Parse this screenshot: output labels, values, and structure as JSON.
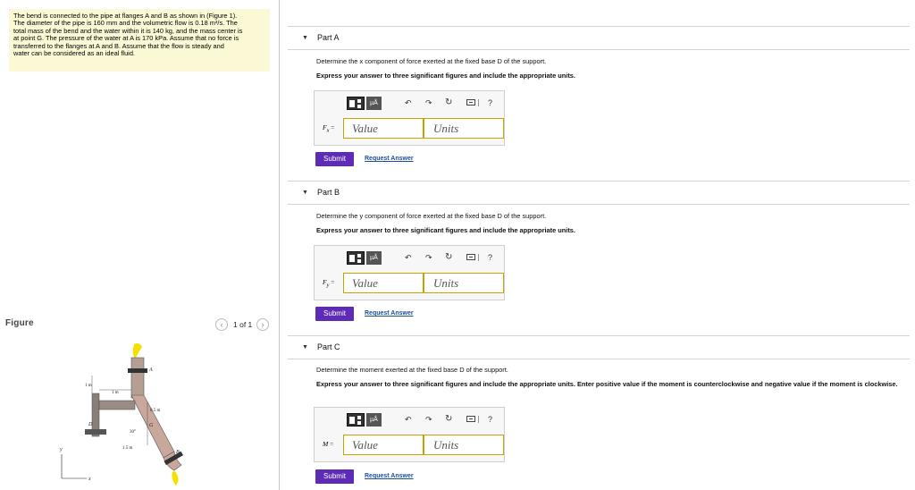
{
  "problem": {
    "lines": [
      "The bend is connected to the pipe at flanges A and B as shown in (Figure 1).",
      "The diameter of the pipe is 160 mm and the volumetric flow is 0.18 m³/s. The",
      "total mass of the bend and the water within it is 140 kg, and the mass center is",
      "at point G. The pressure of the water at A is 170 kPa. Assume that no force is",
      "transferred to the flanges at A and B. Assume that the flow is steady and",
      "water can be considered as an ideal fluid."
    ]
  },
  "figure_panel": {
    "label": "Figure",
    "page_indicator": "1 of 1",
    "prev_icon": "chevron-left-icon",
    "next_icon": "chevron-right-icon",
    "annotations": {
      "A": "A",
      "B": "B",
      "D": "D",
      "G": "G",
      "dim_1m_left": "1 m",
      "dim_1m_top": "1 m",
      "dim_05m": "0.5 m",
      "dim_15m": "1.5 m",
      "angle": "30°",
      "axis_y": "y",
      "axis_x": "x"
    }
  },
  "toolbar": {
    "templates_icon": "templates-icon",
    "units_label": "µÅ",
    "undo_icon": "undo-icon",
    "redo_icon": "redo-icon",
    "reset_icon": "reset-icon",
    "keyboard_icon": "keyboard-icon",
    "help_label": "?"
  },
  "parts": [
    {
      "title": "Part A",
      "toggle_icon": "collapse-triangle-icon",
      "instruction": "Determine the x component of force exerted at the fixed base D of the support.",
      "express": "Express your answer to three significant figures and include the appropriate units.",
      "variable": "F",
      "subscript": "x",
      "equals": "=",
      "value_placeholder": "Value",
      "units_placeholder": "Units",
      "submit_label": "Submit",
      "request_label": "Request Answer"
    },
    {
      "title": "Part B",
      "toggle_icon": "collapse-triangle-icon",
      "instruction": "Determine the y component of force exerted at the fixed base D of the support.",
      "express": "Express your answer to three significant figures and include the appropriate units.",
      "variable": "F",
      "subscript": "y",
      "equals": "=",
      "value_placeholder": "Value",
      "units_placeholder": "Units",
      "submit_label": "Submit",
      "request_label": "Request Answer"
    },
    {
      "title": "Part C",
      "toggle_icon": "collapse-triangle-icon",
      "instruction": "Determine the moment exerted at the fixed base D of the support.",
      "express": "Express your answer to three significant figures and include the appropriate units. Enter positive value if the moment is counterclockwise and negative value if the moment is clockwise.",
      "variable": "M",
      "subscript": "",
      "equals": "=",
      "value_placeholder": "Value",
      "units_placeholder": "Units",
      "submit_label": "Submit",
      "request_label": "Request Answer"
    }
  ],
  "colors": {
    "problem_bg": "#fbf8d6",
    "submit_bg": "#5d2bb5",
    "link": "#1a4fa0",
    "input_border": "#c9a100"
  }
}
